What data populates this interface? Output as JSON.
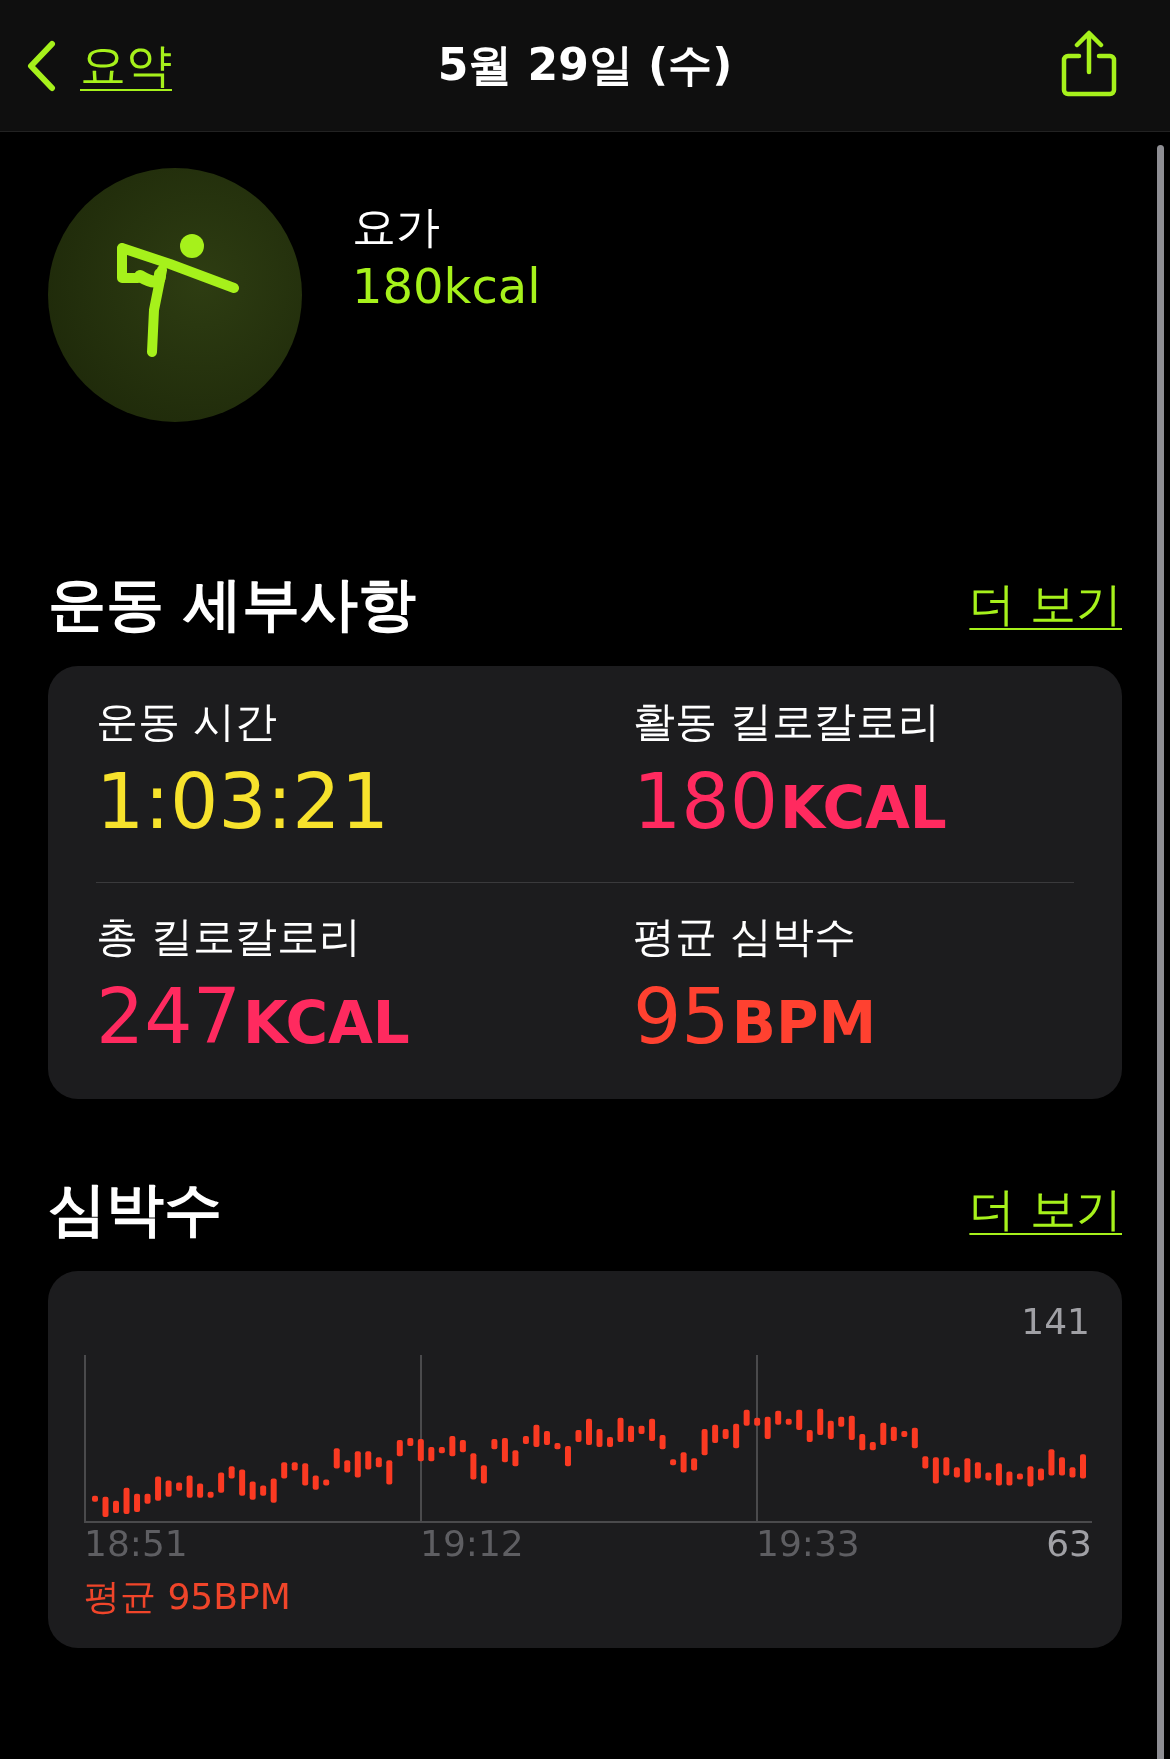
{
  "nav": {
    "back_label": "요약",
    "title": "5월 29일 (수)"
  },
  "workout": {
    "name": "요가",
    "calories": "180kcal"
  },
  "details": {
    "heading": "운동 세부사항",
    "more": "더 보기",
    "stats": [
      {
        "label": "운동 시간",
        "value": "1:03:21",
        "color": "#f7e22c"
      },
      {
        "label": "활동 킬로칼로리",
        "value": "180",
        "unit": "KCAL",
        "color": "#ff2a5f"
      },
      {
        "label": "총 킬로칼로리",
        "value": "247",
        "unit": "KCAL",
        "color": "#ff2a5f"
      },
      {
        "label": "평균 심박수",
        "value": "95",
        "unit": "BPM",
        "color": "#ff4130"
      }
    ]
  },
  "heart_rate": {
    "heading": "심박수",
    "more": "더 보기",
    "max": "141",
    "min": "63",
    "times": [
      "18:51",
      "19:12",
      "19:33"
    ],
    "average": "평균 95BPM"
  }
}
